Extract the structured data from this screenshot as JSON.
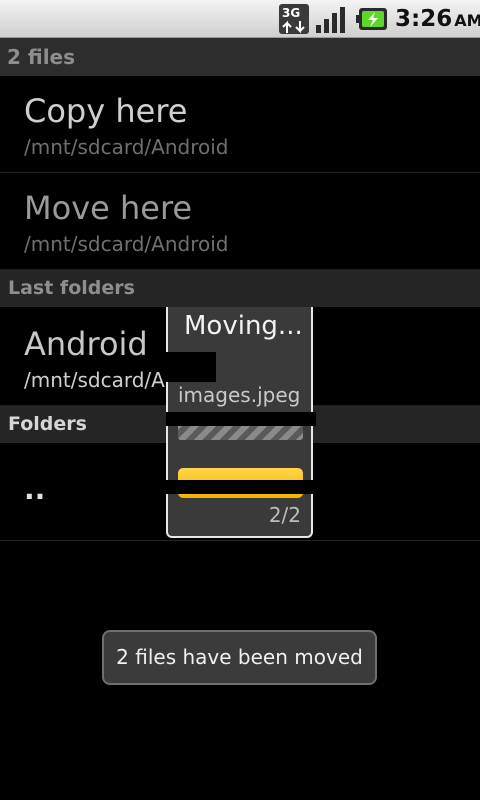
{
  "status_bar": {
    "network": "3G",
    "time": "3:26",
    "ampm": "AM",
    "icons": [
      "3g-data-icon",
      "signal-strength-icon",
      "battery-charging-icon"
    ]
  },
  "title_bar": {
    "title": "2 files"
  },
  "actions": [
    {
      "label": "Copy here",
      "path": "/mnt/sdcard/Android"
    },
    {
      "label": "Move here",
      "path": "/mnt/sdcard/Android"
    }
  ],
  "sections": {
    "last_folders": "Last folders",
    "folders": "Folders"
  },
  "last_folders": [
    {
      "name": "Android",
      "path": "/mnt/sdcard/Android"
    }
  ],
  "folders": [
    {
      "name": ".."
    }
  ],
  "dialog": {
    "title": "Moving...",
    "file": "images.jpeg",
    "count": "2/2",
    "file_progress": 1.0,
    "total_progress": 1.0
  },
  "toast": {
    "message": "2 files have been moved"
  },
  "colors": {
    "accent_yellow": "#f2b400",
    "background": "#000000",
    "section_bg": "#252525"
  }
}
